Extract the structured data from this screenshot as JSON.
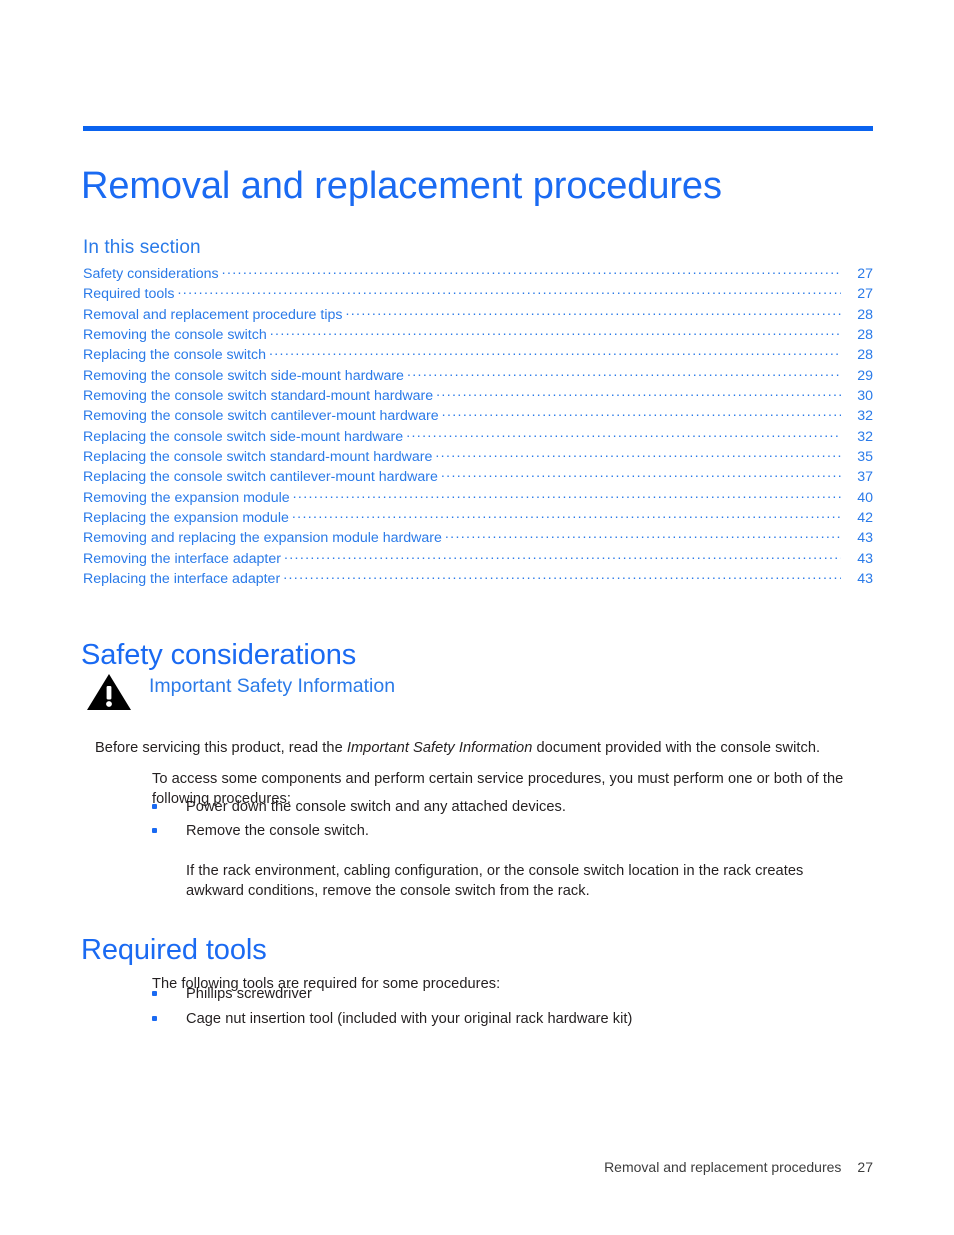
{
  "document": {
    "title": "Removal and replacement procedures"
  },
  "colors": {
    "heading_blue": "#1a6af2",
    "link_blue": "#2a7ae8",
    "rule_blue": "#0a63ef",
    "body_black": "#231f20"
  },
  "toc": {
    "heading": "In this section",
    "entries": [
      {
        "label": "Safety considerations",
        "page": "27"
      },
      {
        "label": "Required tools",
        "page": "27"
      },
      {
        "label": "Removal and replacement procedure tips",
        "page": "28"
      },
      {
        "label": "Removing the console switch",
        "page": "28"
      },
      {
        "label": "Replacing the console switch",
        "page": "28"
      },
      {
        "label": "Removing the console switch side-mount hardware",
        "page": "29"
      },
      {
        "label": "Removing the console switch standard-mount hardware",
        "page": "30"
      },
      {
        "label": "Removing the console switch cantilever-mount hardware",
        "page": "32"
      },
      {
        "label": "Replacing the console switch side-mount hardware",
        "page": "32"
      },
      {
        "label": "Replacing the console switch standard-mount hardware",
        "page": "35"
      },
      {
        "label": "Replacing the console switch cantilever-mount hardware",
        "page": "37"
      },
      {
        "label": "Removing the expansion module",
        "page": "40"
      },
      {
        "label": "Replacing the expansion module",
        "page": "42"
      },
      {
        "label": "Removing and replacing the expansion module hardware",
        "page": "43"
      },
      {
        "label": "Removing the interface adapter",
        "page": "43"
      },
      {
        "label": "Replacing the interface adapter",
        "page": "43"
      }
    ]
  },
  "safety": {
    "heading": "Safety considerations",
    "warning_icon": "warning-triangle-icon",
    "warning_title": "Important Safety Information",
    "intro_before": "Before servicing this product, read the ",
    "intro_italic": "Important Safety Information",
    "intro_after": " document provided with the console switch.",
    "access_paragraph": "To access some components and perform certain service procedures, you must perform one or both of the following procedures:",
    "bullets": [
      "Power down the console switch and any attached devices.",
      "Remove the console switch."
    ],
    "rack_note": "If the rack environment, cabling configuration, or the console switch location in the rack creates awkward conditions, remove the console switch from the rack."
  },
  "tools": {
    "heading": "Required tools",
    "intro": "The following tools are required for some procedures:",
    "bullets": [
      "Phillips screwdriver",
      "Cage nut insertion tool (included with your original rack hardware kit)"
    ]
  },
  "footer": {
    "chapter": "Removal and replacement procedures",
    "page_number": "27"
  }
}
